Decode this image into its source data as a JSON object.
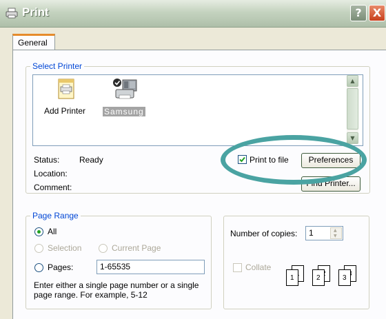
{
  "window": {
    "title": "Print",
    "help_label": "?",
    "close_label": "X"
  },
  "tabs": [
    {
      "label": "General"
    }
  ],
  "select_printer": {
    "legend": "Select Printer",
    "printers": [
      {
        "label": "Add Printer",
        "icon": "add-printer-icon",
        "selected": false
      },
      {
        "label": "Samsung",
        "icon": "printer-icon",
        "selected": true
      }
    ]
  },
  "status": {
    "status_label": "Status:",
    "status_value": "Ready",
    "location_label": "Location:",
    "location_value": "",
    "comment_label": "Comment:",
    "comment_value": ""
  },
  "print_to_file": {
    "label": "Print to file",
    "checked": true
  },
  "buttons": {
    "preferences": "Preferences",
    "find_printer": "Find Printer..."
  },
  "page_range": {
    "legend": "Page Range",
    "all": "All",
    "selection": "Selection",
    "current_page": "Current Page",
    "pages": "Pages:",
    "pages_value": "1-65535",
    "hint_line1": "Enter either a single page number or a single",
    "hint_line2": "page range.  For example, 5-12"
  },
  "copies": {
    "label": "Number of copies:",
    "value": "1",
    "collate_label": "Collate",
    "collate_checked": false,
    "stack_labels": [
      "1",
      "1",
      "2",
      "2",
      "3",
      "3"
    ]
  },
  "colors": {
    "highlight_ellipse": "#4aa3a2",
    "group_legend": "#0046d5",
    "selected_bg": "#316ac5"
  }
}
